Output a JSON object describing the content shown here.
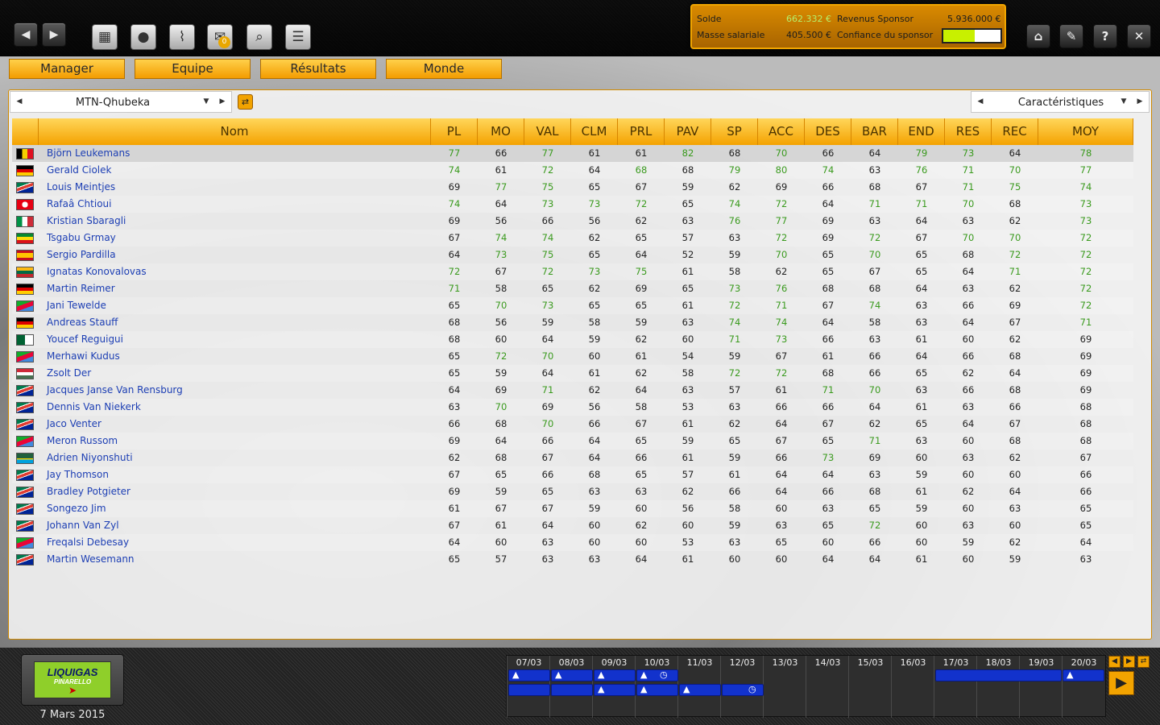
{
  "toolbar": {
    "icons": [
      "back-arrow-icon",
      "forward-arrow-icon",
      "calendar-icon",
      "team-icon",
      "chart-icon",
      "mail-icon",
      "search-icon",
      "notepad-icon"
    ],
    "mail_badge": "0"
  },
  "finance": {
    "solde_label": "Solde",
    "solde_value": "662.332 €",
    "revenus_label": "Revenus Sponsor",
    "revenus_value": "5.936.000 €",
    "masse_label": "Masse salariale",
    "masse_value": "405.500 €",
    "confiance_label": "Confiance du sponsor",
    "confiance_level": 0.55,
    "confiance_color": "#c8f000"
  },
  "menu": {
    "tabs": [
      "Manager",
      "Equipe",
      "Résultats",
      "Monde"
    ]
  },
  "team_select": {
    "value": "MTN-Qhubeka"
  },
  "view_select": {
    "value": "Caractéristiques"
  },
  "table": {
    "columns": [
      "Nom",
      "PL",
      "MO",
      "VAL",
      "CLM",
      "PRL",
      "PAV",
      "SP",
      "ACC",
      "DES",
      "BAR",
      "END",
      "RES",
      "REC",
      "MOY"
    ],
    "rows": [
      {
        "flag": "BE",
        "name": "Björn Leukemans",
        "v": [
          77,
          66,
          77,
          61,
          61,
          82,
          68,
          70,
          66,
          64,
          79,
          73,
          64,
          78
        ],
        "hi": [
          0,
          2,
          5,
          7,
          10,
          11,
          13
        ]
      },
      {
        "flag": "DE",
        "name": "Gerald Ciolek",
        "v": [
          74,
          61,
          72,
          64,
          68,
          68,
          79,
          80,
          74,
          63,
          76,
          71,
          70,
          77
        ],
        "hi": [
          0,
          2,
          4,
          6,
          7,
          8,
          10,
          11,
          12,
          13
        ]
      },
      {
        "flag": "ZA",
        "name": "Louis Meintjes",
        "v": [
          69,
          77,
          75,
          65,
          67,
          59,
          62,
          69,
          66,
          68,
          67,
          71,
          75,
          74
        ],
        "hi": [
          1,
          2,
          11,
          12,
          13
        ]
      },
      {
        "flag": "TN",
        "name": "Rafaâ Chtioui",
        "v": [
          74,
          64,
          73,
          73,
          72,
          65,
          74,
          72,
          64,
          71,
          71,
          70,
          68,
          73
        ],
        "hi": [
          0,
          2,
          3,
          4,
          6,
          7,
          9,
          10,
          11,
          13
        ]
      },
      {
        "flag": "IT",
        "name": "Kristian Sbaragli",
        "v": [
          69,
          56,
          66,
          56,
          62,
          63,
          76,
          77,
          69,
          63,
          64,
          63,
          62,
          73
        ],
        "hi": [
          6,
          7,
          13
        ]
      },
      {
        "flag": "ET",
        "name": "Tsgabu Grmay",
        "v": [
          67,
          74,
          74,
          62,
          65,
          57,
          63,
          72,
          69,
          72,
          67,
          70,
          70,
          72
        ],
        "hi": [
          1,
          2,
          7,
          9,
          11,
          12,
          13
        ]
      },
      {
        "flag": "ES",
        "name": "Sergio Pardilla",
        "v": [
          64,
          73,
          75,
          65,
          64,
          52,
          59,
          70,
          65,
          70,
          65,
          68,
          72,
          72
        ],
        "hi": [
          1,
          2,
          7,
          9,
          12,
          13
        ]
      },
      {
        "flag": "LT",
        "name": "Ignatas Konovalovas",
        "v": [
          72,
          67,
          72,
          73,
          75,
          61,
          58,
          62,
          65,
          67,
          65,
          64,
          71,
          72
        ],
        "hi": [
          0,
          2,
          3,
          4,
          12,
          13
        ]
      },
      {
        "flag": "DE",
        "name": "Martin Reimer",
        "v": [
          71,
          58,
          65,
          62,
          69,
          65,
          73,
          76,
          68,
          68,
          64,
          63,
          62,
          72
        ],
        "hi": [
          0,
          6,
          7,
          13
        ]
      },
      {
        "flag": "ER",
        "name": "Jani Tewelde",
        "v": [
          65,
          70,
          73,
          65,
          65,
          61,
          72,
          71,
          67,
          74,
          63,
          66,
          69,
          72
        ],
        "hi": [
          1,
          2,
          6,
          7,
          9,
          13
        ]
      },
      {
        "flag": "DE",
        "name": "Andreas Stauff",
        "v": [
          68,
          56,
          59,
          58,
          59,
          63,
          74,
          74,
          64,
          58,
          63,
          64,
          67,
          71
        ],
        "hi": [
          6,
          7,
          13
        ]
      },
      {
        "flag": "DZ",
        "name": "Youcef Reguigui",
        "v": [
          68,
          60,
          64,
          59,
          62,
          60,
          71,
          73,
          66,
          63,
          61,
          60,
          62,
          69
        ],
        "hi": [
          6,
          7
        ]
      },
      {
        "flag": "ER",
        "name": "Merhawi Kudus",
        "v": [
          65,
          72,
          70,
          60,
          61,
          54,
          59,
          67,
          61,
          66,
          64,
          66,
          68,
          69
        ],
        "hi": [
          1,
          2
        ]
      },
      {
        "flag": "HU",
        "name": "Zsolt Der",
        "v": [
          65,
          59,
          64,
          61,
          62,
          58,
          72,
          72,
          68,
          66,
          65,
          62,
          64,
          69
        ],
        "hi": [
          6,
          7
        ]
      },
      {
        "flag": "ZA",
        "name": "Jacques Janse Van Rensburg",
        "v": [
          64,
          69,
          71,
          62,
          64,
          63,
          57,
          61,
          71,
          70,
          63,
          66,
          68,
          69
        ],
        "hi": [
          2,
          8,
          9
        ]
      },
      {
        "flag": "ZA",
        "name": "Dennis Van Niekerk",
        "v": [
          63,
          70,
          69,
          56,
          58,
          53,
          63,
          66,
          66,
          64,
          61,
          63,
          66,
          68
        ],
        "hi": [
          1
        ]
      },
      {
        "flag": "ZA",
        "name": "Jaco Venter",
        "v": [
          66,
          68,
          70,
          66,
          67,
          61,
          62,
          64,
          67,
          62,
          65,
          64,
          67,
          68
        ],
        "hi": [
          2
        ]
      },
      {
        "flag": "ER",
        "name": "Meron Russom",
        "v": [
          69,
          64,
          66,
          64,
          65,
          59,
          65,
          67,
          65,
          71,
          63,
          60,
          68,
          68
        ],
        "hi": [
          9
        ]
      },
      {
        "flag": "RW",
        "name": "Adrien Niyonshuti",
        "v": [
          62,
          68,
          67,
          64,
          66,
          61,
          59,
          66,
          73,
          69,
          60,
          63,
          62,
          67
        ],
        "hi": [
          8
        ]
      },
      {
        "flag": "ZA",
        "name": "Jay Thomson",
        "v": [
          67,
          65,
          66,
          68,
          65,
          57,
          61,
          64,
          64,
          63,
          59,
          60,
          60,
          66
        ],
        "hi": []
      },
      {
        "flag": "ZA",
        "name": "Bradley Potgieter",
        "v": [
          69,
          59,
          65,
          63,
          63,
          62,
          66,
          64,
          66,
          68,
          61,
          62,
          64,
          66
        ],
        "hi": []
      },
      {
        "flag": "ZA",
        "name": "Songezo Jim",
        "v": [
          61,
          67,
          67,
          59,
          60,
          56,
          58,
          60,
          63,
          65,
          59,
          60,
          63,
          65
        ],
        "hi": []
      },
      {
        "flag": "ZA",
        "name": "Johann Van Zyl",
        "v": [
          67,
          61,
          64,
          60,
          62,
          60,
          59,
          63,
          65,
          72,
          60,
          63,
          60,
          65
        ],
        "hi": [
          9
        ]
      },
      {
        "flag": "ER",
        "name": "Freqalsi Debesay",
        "v": [
          64,
          60,
          63,
          60,
          60,
          53,
          63,
          65,
          60,
          66,
          60,
          59,
          62,
          64
        ],
        "hi": []
      },
      {
        "flag": "ZA",
        "name": "Martin Wesemann",
        "v": [
          65,
          57,
          63,
          63,
          64,
          61,
          60,
          60,
          64,
          64,
          61,
          60,
          59,
          63
        ],
        "hi": []
      }
    ]
  },
  "team_logo": {
    "line1": "LIQUIGAS",
    "line2": "PINARELLO"
  },
  "current_date": "7 Mars 2015",
  "calendar": {
    "days": [
      "07/03",
      "08/03",
      "09/03",
      "10/03",
      "11/03",
      "12/03",
      "13/03",
      "14/03",
      "15/03",
      "16/03",
      "17/03",
      "18/03",
      "19/03",
      "20/03"
    ]
  }
}
